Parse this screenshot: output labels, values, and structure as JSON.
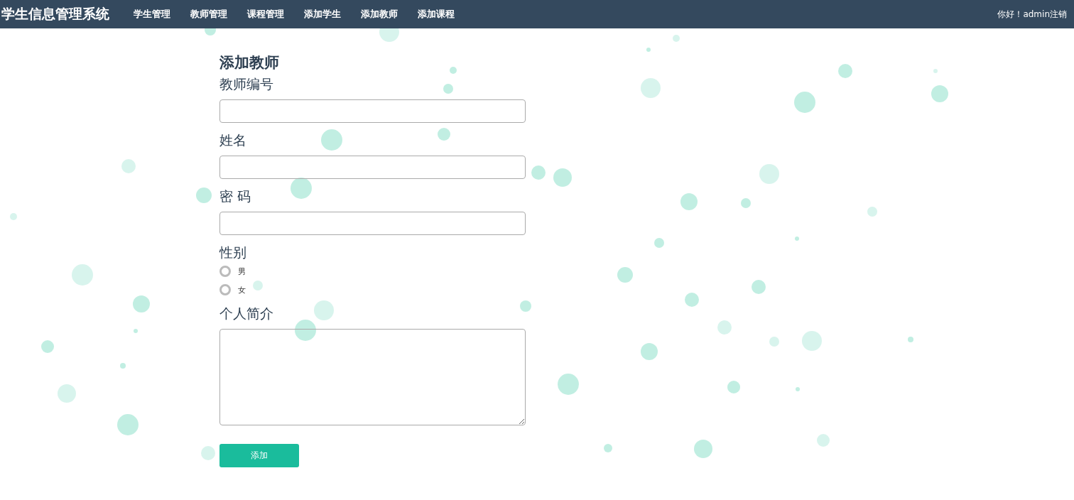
{
  "brand": "学生信息管理系统",
  "nav": [
    "学生管理",
    "教师管理",
    "课程管理",
    "添加学生",
    "添加教师",
    "添加课程"
  ],
  "user": {
    "greeting": "你好！admin",
    "logout": "注销"
  },
  "form": {
    "title": "添加教师",
    "fields": [
      {
        "kind": "text",
        "label": "教师编号"
      },
      {
        "kind": "text",
        "label": "姓名"
      },
      {
        "kind": "password",
        "label": "密 码"
      },
      {
        "kind": "radio",
        "label": "性别",
        "options": [
          {
            "label": "男",
            "selected": false
          },
          {
            "label": "女",
            "selected": false
          }
        ]
      },
      {
        "kind": "textarea",
        "label": "个人简介"
      }
    ],
    "submit": "添加"
  }
}
